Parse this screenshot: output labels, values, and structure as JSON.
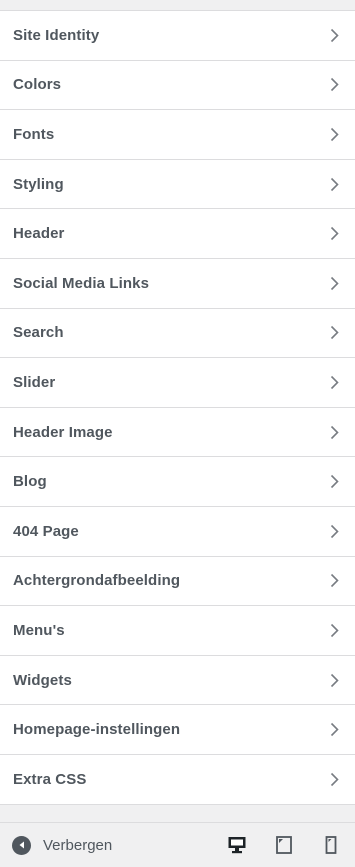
{
  "menu": {
    "items": [
      {
        "label": "Site Identity"
      },
      {
        "label": "Colors"
      },
      {
        "label": "Fonts"
      },
      {
        "label": "Styling"
      },
      {
        "label": "Header"
      },
      {
        "label": "Social Media Links"
      },
      {
        "label": "Search"
      },
      {
        "label": "Slider"
      },
      {
        "label": "Header Image"
      },
      {
        "label": "Blog"
      },
      {
        "label": "404 Page"
      },
      {
        "label": "Achtergrondafbeelding"
      },
      {
        "label": "Menu's"
      },
      {
        "label": "Widgets"
      },
      {
        "label": "Homepage-instellingen"
      },
      {
        "label": "Extra CSS"
      }
    ]
  },
  "footer": {
    "collapse_label": "Verbergen",
    "collapse_icon": "arrow-left-circle-icon",
    "devices": [
      {
        "name": "desktop",
        "icon": "desktop-icon",
        "active": true
      },
      {
        "name": "tablet",
        "icon": "tablet-icon",
        "active": false
      },
      {
        "name": "mobile",
        "icon": "mobile-icon",
        "active": false
      }
    ]
  },
  "colors": {
    "text": "#50575e",
    "active_icon": "#1d2327",
    "border": "#dcdcde",
    "item_bg": "#ffffff",
    "footer_bg": "#f0f0f1"
  }
}
